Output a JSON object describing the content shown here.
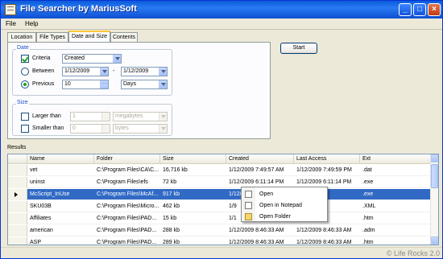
{
  "window": {
    "title": "File Searcher by MariusSoft"
  },
  "menu": [
    "File",
    "Help"
  ],
  "tabs": [
    "Location",
    "File Types",
    "Date and Size",
    "Contents"
  ],
  "date_group": {
    "title": "Date",
    "criteria_label": "Criteria",
    "criteria_checked": true,
    "criteria_value": "Created",
    "between_label": "Between",
    "between_from": "1/12/2009",
    "between_sep": "-",
    "between_to": "1/12/2009",
    "previous_label": "Previous",
    "previous_value": "10",
    "previous_unit": "Days",
    "selected_option": "Previous"
  },
  "size_group": {
    "title": "Size",
    "larger_label": "Larger than",
    "larger_value": "1",
    "larger_unit": "megabytes",
    "smaller_label": "Smaller than",
    "smaller_value": "0",
    "smaller_unit": "bytes"
  },
  "start_button": "Start",
  "results_label": "Results",
  "columns": [
    "Name",
    "Folder",
    "Size",
    "Created",
    "Last Access",
    "Ext"
  ],
  "rows": [
    {
      "name": "vet",
      "folder": "C:\\Program Files\\CA\\C...",
      "size": "16,716 kb",
      "created": "1/12/2009 7:49:57 AM",
      "access": "1/12/2009 7:49:59 PM",
      "ext": ".dat"
    },
    {
      "name": "uninst",
      "folder": "C:\\Program Files\\efs",
      "size": "72 kb",
      "created": "1/12/2009 6:11:14 PM",
      "access": "1/12/2009 6:11:14 PM",
      "ext": ".exe"
    },
    {
      "name": "McScript_InUse",
      "folder": "C:\\Program Files\\McAf...",
      "size": "917 kb",
      "created": "1/12/2009 6:1",
      "access": "05:00 PM",
      "ext": ".exe"
    },
    {
      "name": "SKU03B",
      "folder": "C:\\Program Files\\Micro...",
      "size": "462 kb",
      "created": "1/9",
      "access": "",
      "ext": ".XML"
    },
    {
      "name": "Affiliates",
      "folder": "C:\\Program Files\\PAD...",
      "size": "15 kb",
      "created": "1/1",
      "access": "0:22:13 PM",
      "ext": ".htm"
    },
    {
      "name": "american",
      "folder": "C:\\Program Files\\PAD...",
      "size": "288 kb",
      "created": "1/12/2009 8:46:33 AM",
      "access": "1/12/2009 8:46:33 AM",
      "ext": ".adm"
    },
    {
      "name": "ASP",
      "folder": "C:\\Program Files\\PAD...",
      "size": "289 kb",
      "created": "1/12/2009 8:46:33 AM",
      "access": "1/12/2009 8:46:33 AM",
      "ext": ".htm"
    }
  ],
  "context_menu": [
    "Open",
    "Open in Notepad",
    "Open Folder"
  ],
  "watermark": "© Life Rocks 2.0"
}
